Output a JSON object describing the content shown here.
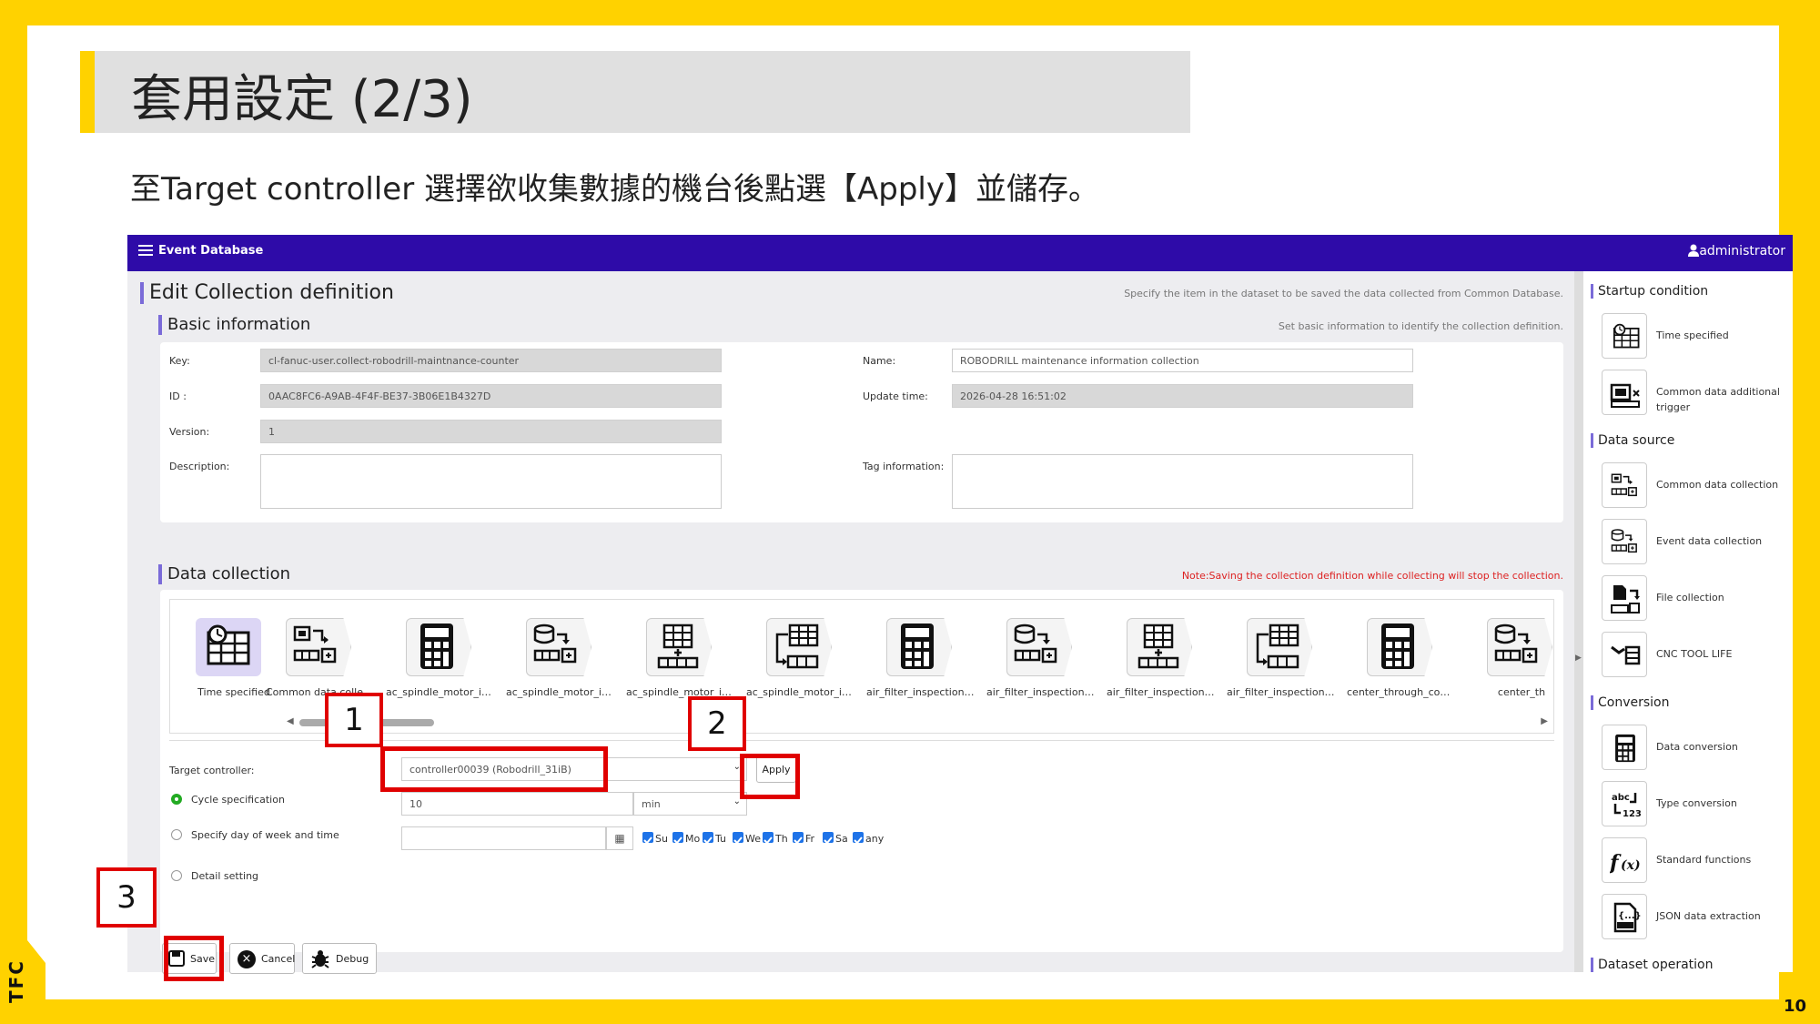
{
  "slide": {
    "title": "套用設定 (2/3)",
    "subtitle": "至Target controller 選擇欲收集數據的機台後點選【Apply】並儲存。",
    "page_number": "10",
    "logo": "TFC"
  },
  "topbar": {
    "menu_icon": "hamburger-icon",
    "app_name": "Event Database",
    "user": "administrator"
  },
  "page": {
    "title": "Edit Collection definition",
    "title_hint": "Specify the item in the dataset to be saved the data collected from Common Database.",
    "basic_title": "Basic information",
    "basic_hint": "Set basic information to identify the collection definition.",
    "fields": {
      "key_label": "Key:",
      "key_value": "cl-fanuc-user.collect-robodrill-maintnance-counter",
      "id_label": "ID :",
      "id_value": "0AAC8FC6-A9AB-4F4F-BE37-3B06E1B4327D",
      "version_label": "Version:",
      "version_value": "1",
      "description_label": "Description:",
      "name_label": "Name:",
      "name_value": "ROBODRILL maintenance information collection",
      "update_label": "Update time:",
      "update_value": "2026-04-28 16:51:02",
      "tag_label": "Tag information:"
    },
    "data_title": "Data collection",
    "data_note": "Note:Saving the collection definition while collecting will stop the collection.",
    "nodes": [
      "Time specified",
      "Common data collec...",
      "ac_spindle_motor_in...",
      "ac_spindle_motor_in...",
      "ac_spindle_motor_in...",
      "ac_spindle_motor_in...",
      "air_filter_inspection ...",
      "air_filter_inspection ...",
      "air_filter_inspection r...",
      "air_filter_inspection r...",
      "center_through_cool...",
      "center_th"
    ],
    "target_label": "Target controller:",
    "target_value": "controller00039 (Robodrill_31iB)",
    "apply": "Apply",
    "cycle_label": "Cycle specification",
    "cycle_value": "10",
    "cycle_unit": "min",
    "dow_label": "Specify day of week and time",
    "days": [
      "Su",
      "Mo",
      "Tu",
      "We",
      "Th",
      "Fr",
      "Sa",
      "any"
    ],
    "detail_label": "Detail setting",
    "save": "Save",
    "cancel": "Cancel",
    "debug": "Debug"
  },
  "sidebar": {
    "sections": [
      {
        "title": "Startup condition",
        "items": [
          "Time specified",
          "Common data additional trigger"
        ]
      },
      {
        "title": "Data source",
        "items": [
          "Common data collection",
          "Event data collection",
          "File collection",
          "CNC TOOL LIFE"
        ]
      },
      {
        "title": "Conversion",
        "items": [
          "Data conversion",
          "Type conversion",
          "Standard functions",
          "JSON data extraction"
        ]
      },
      {
        "title": "Dataset operation",
        "items": []
      }
    ]
  },
  "markers": [
    "1",
    "2",
    "3"
  ]
}
